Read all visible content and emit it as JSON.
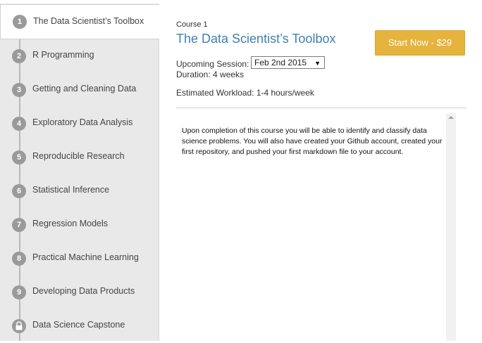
{
  "sidebar": {
    "items": [
      {
        "number": "1",
        "label": "The Data Scientist’s Toolbox"
      },
      {
        "number": "2",
        "label": "R Programming"
      },
      {
        "number": "3",
        "label": "Getting and Cleaning Data"
      },
      {
        "number": "4",
        "label": "Exploratory Data Analysis"
      },
      {
        "number": "5",
        "label": "Reproducible Research"
      },
      {
        "number": "6",
        "label": "Statistical Inference"
      },
      {
        "number": "7",
        "label": "Regression Models"
      },
      {
        "number": "8",
        "label": "Practical Machine Learning"
      },
      {
        "number": "9",
        "label": "Developing Data Products"
      },
      {
        "number": "",
        "label": "Data Science Capstone",
        "icon": "lock-icon"
      }
    ]
  },
  "course": {
    "number_label": "Course 1",
    "title": "The Data Scientist’s Toolbox",
    "start_button": "Start Now - $29",
    "session_label": "Upcoming Session:",
    "session_value": "Feb 2nd 2015",
    "duration": "Duration: 4 weeks",
    "workload": "Estimated Workload: 1-4 hours/week",
    "description": "Upon completion of this course you will be able to identify and classify data science problems. You will also have created your Github account, created your first repository, and pushed your first markdown file to your account."
  },
  "colors": {
    "accent": "#3f7fb4",
    "button": "#e6b33d"
  }
}
